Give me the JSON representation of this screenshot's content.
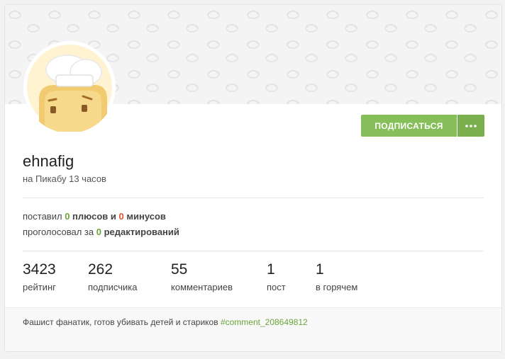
{
  "profile": {
    "username": "ehnafig",
    "since": "на Пикабу 13 часов"
  },
  "actions": {
    "subscribe_label": "ПОДПИСАТЬСЯ",
    "more_icon": "ellipsis-icon"
  },
  "votes": {
    "line1_prefix": "поставил",
    "pluses": "0",
    "pluses_word": "плюсов",
    "conj": "и",
    "minuses": "0",
    "minuses_word": "минусов",
    "line2_prefix": "проголосовал за",
    "edits": "0",
    "edits_word": "редактирований"
  },
  "stats": [
    {
      "value": "3423",
      "label": "рейтинг"
    },
    {
      "value": "262",
      "label": "подписчика"
    },
    {
      "value": "55",
      "label": "комментариев"
    },
    {
      "value": "1",
      "label": "пост"
    },
    {
      "value": "1",
      "label": "в горячем"
    }
  ],
  "bio": {
    "text": "Фашист фанатик, готов убивать детей и стариков",
    "link": "#comment_208649812"
  },
  "colors": {
    "accent_green": "#86be59",
    "positive": "#6aa33a",
    "negative": "#dd5533"
  }
}
